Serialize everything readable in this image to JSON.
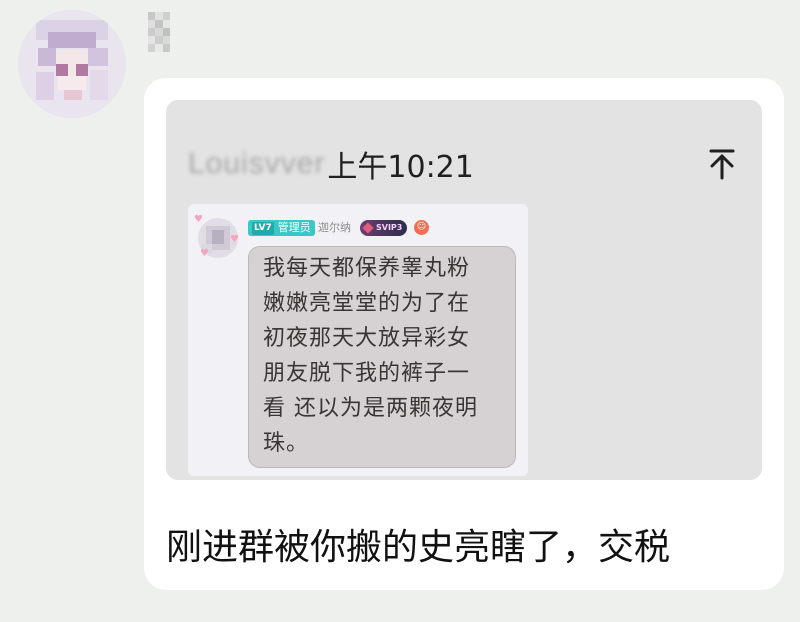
{
  "sender": {
    "avatar_icon": "anime-avatar-icon"
  },
  "message": {
    "quote": {
      "author_blurred": "Louisvver",
      "time": "上午10:21",
      "pin_icon": "pin-top-icon",
      "screenshot": {
        "level_badge": {
          "level": "LV7",
          "role": "管理员"
        },
        "sender_name": "迦尔纳",
        "vip_badge": "SVIP3",
        "lines": [
          "我每天都保养睾丸粉",
          "嫩嫩亮堂堂的为了在",
          "初夜那天大放异彩女",
          "朋友脱下我的裤子一",
          "看 还以为是两颗夜明",
          "珠。"
        ]
      }
    },
    "text": "刚进群被你搬的史亮瞎了，交税"
  }
}
